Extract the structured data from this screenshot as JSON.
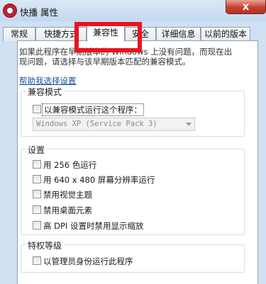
{
  "window": {
    "title": "快播 属性",
    "close_glyph": "x"
  },
  "tabs": [
    {
      "label": "常规"
    },
    {
      "label": "快捷方式"
    },
    {
      "label": "兼容性"
    },
    {
      "label": "安全"
    },
    {
      "label": "详细信息"
    },
    {
      "label": "以前的版本"
    }
  ],
  "description": {
    "line1": "如果此程序在早期版本的 Windows 上没有问题，而现在出",
    "line2": "现问题，请选择与该早期版本匹配的兼容模式。"
  },
  "help_link": "帮助我选择设置",
  "compat_mode": {
    "title": "兼容模式",
    "checkbox_label": "以兼容模式运行这个程序：",
    "selected_os": "Windows XP (Service Pack 3)"
  },
  "settings": {
    "title": "设置",
    "options": [
      "用 256 色运行",
      "用 640 x 480 屏幕分辨率运行",
      "禁用视觉主题",
      "禁用桌面元素",
      "高 DPI 设置时禁用显示缩放"
    ]
  },
  "privilege": {
    "title": "特权等级",
    "option": "以管理员身份运行此程序"
  },
  "colors": {
    "highlight": "#e8141e",
    "link": "#1b4f9c",
    "title_bar": "#c3d8ef"
  }
}
